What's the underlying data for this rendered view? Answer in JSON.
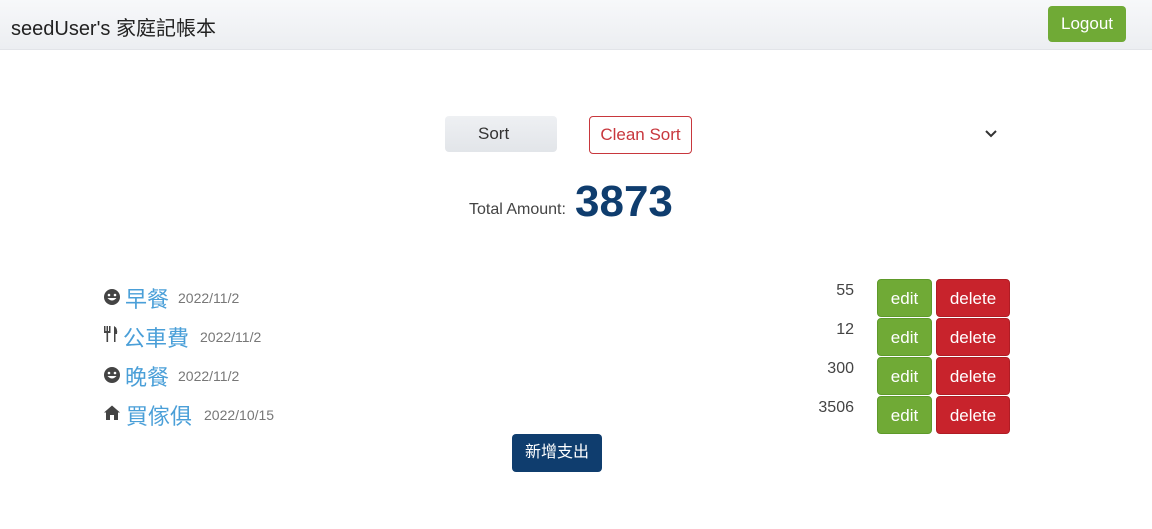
{
  "header": {
    "title": "seedUser's 家庭記帳本",
    "logout_label": "Logout"
  },
  "controls": {
    "sort_label": "Sort",
    "clean_sort_label": "Clean Sort"
  },
  "summary": {
    "total_label": "Total Amount:",
    "total_value": "3873"
  },
  "records": [
    {
      "icon": "smile-icon",
      "title": "早餐",
      "date": "2022/11/2",
      "amount": "55",
      "edit_label": "edit",
      "delete_label": "delete"
    },
    {
      "icon": "utensils-icon",
      "title": "公車費",
      "date": "2022/11/2",
      "amount": "12",
      "edit_label": "edit",
      "delete_label": "delete"
    },
    {
      "icon": "smile-icon",
      "title": "晚餐",
      "date": "2022/11/2",
      "amount": "300",
      "edit_label": "edit",
      "delete_label": "delete"
    },
    {
      "icon": "home-icon",
      "title": "買傢俱",
      "date": "2022/10/15",
      "amount": "3506",
      "edit_label": "edit",
      "delete_label": "delete"
    }
  ],
  "footer": {
    "add_label": "新增支出"
  },
  "colors": {
    "success": "#70aa36",
    "danger": "#c8232c",
    "primary": "#0f3d6e",
    "link": "#4a9fd8"
  }
}
